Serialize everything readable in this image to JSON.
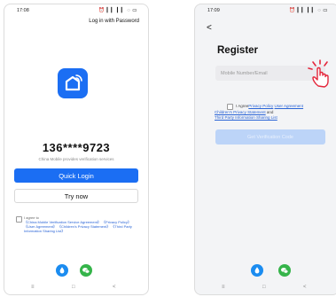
{
  "screen1": {
    "status": {
      "time": "17:08",
      "icons": "⏰ ▎▎ ▎▎ ◌ ▭"
    },
    "password_link": "Log in with Password",
    "phone_number": "136****9723",
    "provider_text": "China Mobile provides verification services",
    "quick_login": "Quick Login",
    "try_now": "Try now",
    "agreement": {
      "prefix": "I agree to",
      "links": "《China Mobile Verification Service Agreement》 《Privacy Policy》 《User Agreement》 《Children's Privacy Statement》 《Third Party Information Sharing List》"
    },
    "nav": {
      "menu": "≡",
      "home": "□",
      "back": "<"
    }
  },
  "screen2": {
    "status": {
      "time": "17:09",
      "icons": "⏰ ▎▎ ▎▎ ◌ ▭"
    },
    "back": "<",
    "title": "Register",
    "mobile_placeholder": "Mobile Number/Email",
    "agreement": {
      "prefix": "I Agree",
      "privacy_policy": "Privacy Policy",
      "user_agreement": "User Agreement",
      "children_privacy": "Children's Privacy Statement",
      "and": " and ",
      "third_party": "Third Party Information Sharing List"
    },
    "verify_button": "Get Verification Code",
    "nav": {
      "menu": "≡",
      "home": "□",
      "back": "<"
    }
  },
  "colors": {
    "primary": "#1b6ef3",
    "disabled": "#bcd4f8",
    "link": "#2a64d6",
    "social_blue": "#1b8cf0",
    "social_green": "#35b44a",
    "hand_accent": "#e4263b"
  }
}
